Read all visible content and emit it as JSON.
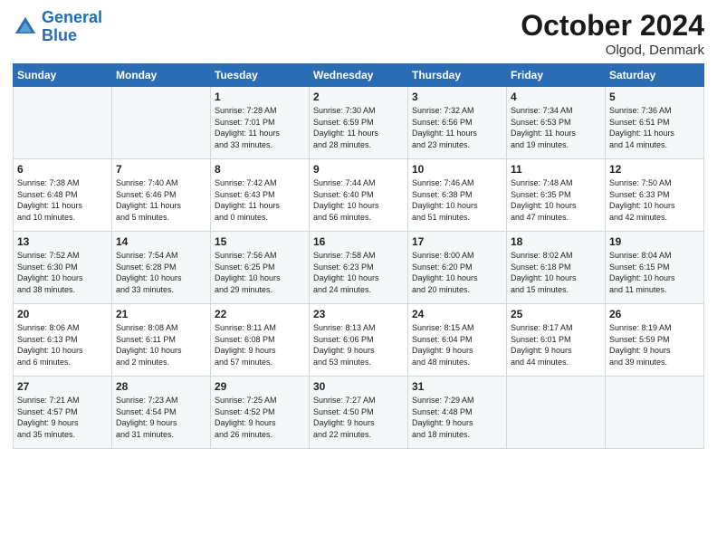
{
  "header": {
    "logo_line1": "General",
    "logo_line2": "Blue",
    "month": "October 2024",
    "location": "Olgod, Denmark"
  },
  "days_of_week": [
    "Sunday",
    "Monday",
    "Tuesday",
    "Wednesday",
    "Thursday",
    "Friday",
    "Saturday"
  ],
  "weeks": [
    [
      {
        "day": "",
        "info": ""
      },
      {
        "day": "",
        "info": ""
      },
      {
        "day": "1",
        "info": "Sunrise: 7:28 AM\nSunset: 7:01 PM\nDaylight: 11 hours\nand 33 minutes."
      },
      {
        "day": "2",
        "info": "Sunrise: 7:30 AM\nSunset: 6:59 PM\nDaylight: 11 hours\nand 28 minutes."
      },
      {
        "day": "3",
        "info": "Sunrise: 7:32 AM\nSunset: 6:56 PM\nDaylight: 11 hours\nand 23 minutes."
      },
      {
        "day": "4",
        "info": "Sunrise: 7:34 AM\nSunset: 6:53 PM\nDaylight: 11 hours\nand 19 minutes."
      },
      {
        "day": "5",
        "info": "Sunrise: 7:36 AM\nSunset: 6:51 PM\nDaylight: 11 hours\nand 14 minutes."
      }
    ],
    [
      {
        "day": "6",
        "info": "Sunrise: 7:38 AM\nSunset: 6:48 PM\nDaylight: 11 hours\nand 10 minutes."
      },
      {
        "day": "7",
        "info": "Sunrise: 7:40 AM\nSunset: 6:46 PM\nDaylight: 11 hours\nand 5 minutes."
      },
      {
        "day": "8",
        "info": "Sunrise: 7:42 AM\nSunset: 6:43 PM\nDaylight: 11 hours\nand 0 minutes."
      },
      {
        "day": "9",
        "info": "Sunrise: 7:44 AM\nSunset: 6:40 PM\nDaylight: 10 hours\nand 56 minutes."
      },
      {
        "day": "10",
        "info": "Sunrise: 7:46 AM\nSunset: 6:38 PM\nDaylight: 10 hours\nand 51 minutes."
      },
      {
        "day": "11",
        "info": "Sunrise: 7:48 AM\nSunset: 6:35 PM\nDaylight: 10 hours\nand 47 minutes."
      },
      {
        "day": "12",
        "info": "Sunrise: 7:50 AM\nSunset: 6:33 PM\nDaylight: 10 hours\nand 42 minutes."
      }
    ],
    [
      {
        "day": "13",
        "info": "Sunrise: 7:52 AM\nSunset: 6:30 PM\nDaylight: 10 hours\nand 38 minutes."
      },
      {
        "day": "14",
        "info": "Sunrise: 7:54 AM\nSunset: 6:28 PM\nDaylight: 10 hours\nand 33 minutes."
      },
      {
        "day": "15",
        "info": "Sunrise: 7:56 AM\nSunset: 6:25 PM\nDaylight: 10 hours\nand 29 minutes."
      },
      {
        "day": "16",
        "info": "Sunrise: 7:58 AM\nSunset: 6:23 PM\nDaylight: 10 hours\nand 24 minutes."
      },
      {
        "day": "17",
        "info": "Sunrise: 8:00 AM\nSunset: 6:20 PM\nDaylight: 10 hours\nand 20 minutes."
      },
      {
        "day": "18",
        "info": "Sunrise: 8:02 AM\nSunset: 6:18 PM\nDaylight: 10 hours\nand 15 minutes."
      },
      {
        "day": "19",
        "info": "Sunrise: 8:04 AM\nSunset: 6:15 PM\nDaylight: 10 hours\nand 11 minutes."
      }
    ],
    [
      {
        "day": "20",
        "info": "Sunrise: 8:06 AM\nSunset: 6:13 PM\nDaylight: 10 hours\nand 6 minutes."
      },
      {
        "day": "21",
        "info": "Sunrise: 8:08 AM\nSunset: 6:11 PM\nDaylight: 10 hours\nand 2 minutes."
      },
      {
        "day": "22",
        "info": "Sunrise: 8:11 AM\nSunset: 6:08 PM\nDaylight: 9 hours\nand 57 minutes."
      },
      {
        "day": "23",
        "info": "Sunrise: 8:13 AM\nSunset: 6:06 PM\nDaylight: 9 hours\nand 53 minutes."
      },
      {
        "day": "24",
        "info": "Sunrise: 8:15 AM\nSunset: 6:04 PM\nDaylight: 9 hours\nand 48 minutes."
      },
      {
        "day": "25",
        "info": "Sunrise: 8:17 AM\nSunset: 6:01 PM\nDaylight: 9 hours\nand 44 minutes."
      },
      {
        "day": "26",
        "info": "Sunrise: 8:19 AM\nSunset: 5:59 PM\nDaylight: 9 hours\nand 39 minutes."
      }
    ],
    [
      {
        "day": "27",
        "info": "Sunrise: 7:21 AM\nSunset: 4:57 PM\nDaylight: 9 hours\nand 35 minutes."
      },
      {
        "day": "28",
        "info": "Sunrise: 7:23 AM\nSunset: 4:54 PM\nDaylight: 9 hours\nand 31 minutes."
      },
      {
        "day": "29",
        "info": "Sunrise: 7:25 AM\nSunset: 4:52 PM\nDaylight: 9 hours\nand 26 minutes."
      },
      {
        "day": "30",
        "info": "Sunrise: 7:27 AM\nSunset: 4:50 PM\nDaylight: 9 hours\nand 22 minutes."
      },
      {
        "day": "31",
        "info": "Sunrise: 7:29 AM\nSunset: 4:48 PM\nDaylight: 9 hours\nand 18 minutes."
      },
      {
        "day": "",
        "info": ""
      },
      {
        "day": "",
        "info": ""
      }
    ]
  ]
}
